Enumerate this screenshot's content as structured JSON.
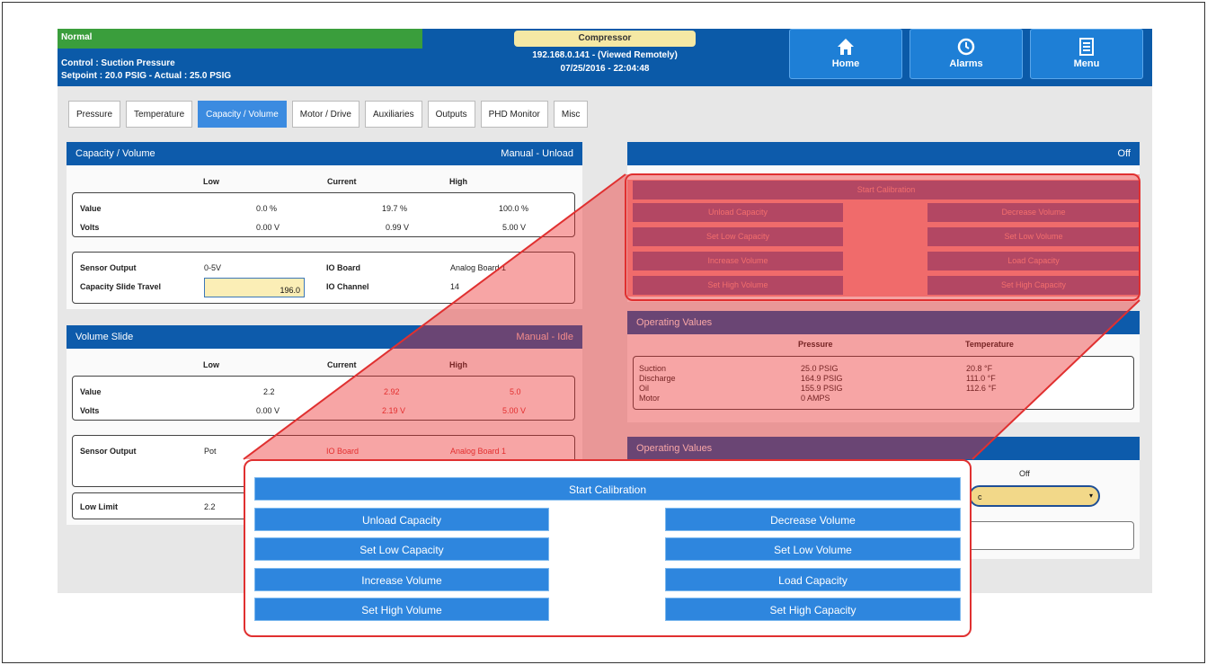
{
  "header": {
    "status": "Normal",
    "control": "Control : Suction Pressure",
    "setpoint": "Setpoint : 20.0 PSIG - Actual : 25.0 PSIG",
    "unit": "Compressor",
    "address": "192.168.0.141 - (Viewed Remotely)",
    "datetime": "07/25/2016 - 22:04:48",
    "nav": [
      {
        "label": "Home",
        "icon": "home-icon"
      },
      {
        "label": "Alarms",
        "icon": "clock-icon"
      },
      {
        "label": "Menu",
        "icon": "menu-icon"
      }
    ]
  },
  "tabs": [
    "Pressure",
    "Temperature",
    "Capacity / Volume",
    "Motor / Drive",
    "Auxiliaries",
    "Outputs",
    "PHD Monitor",
    "Misc"
  ],
  "active_tab": "Capacity / Volume",
  "capacity": {
    "title": "Capacity / Volume",
    "mode": "Manual - Unload",
    "cols": {
      "low": "Low",
      "current": "Current",
      "high": "High"
    },
    "value": {
      "label": "Value",
      "low": "0.0 %",
      "current": "19.7 %",
      "high": "100.0 %"
    },
    "volts": {
      "label": "Volts",
      "low": "0.00 V",
      "current": "0.99 V",
      "high": "5.00 V"
    },
    "sensor_output_label": "Sensor Output",
    "sensor_output": "0-5V",
    "io_board_label": "IO Board",
    "io_board": "Analog Board 1",
    "slide_travel_label": "Capacity Slide Travel",
    "slide_travel": "196.0",
    "io_channel_label": "IO Channel",
    "io_channel": "14"
  },
  "volume": {
    "title": "Volume Slide",
    "mode": "Manual - Idle",
    "cols": {
      "low": "Low",
      "current": "Current",
      "high": "High"
    },
    "value": {
      "label": "Value",
      "low": "2.2",
      "current": "2.92",
      "high": "5.0"
    },
    "volts": {
      "label": "Volts",
      "low": "0.00 V",
      "current": "2.19 V",
      "high": "5.00 V"
    },
    "sensor_output_label": "Sensor Output",
    "sensor_output": "Pot",
    "io_board_label": "IO Board",
    "io_board": "Analog Board 1",
    "low_limit_label": "Low Limit",
    "low_limit": "2.2"
  },
  "calibration": {
    "state": "Off",
    "start": "Start Calibration",
    "left": [
      "Unload Capacity",
      "Set Low Capacity",
      "Increase Volume",
      "Set High Volume"
    ],
    "right": [
      "Decrease Volume",
      "Set Low Volume",
      "Load Capacity",
      "Set High Capacity"
    ]
  },
  "operating": {
    "title": "Operating Values",
    "cols": {
      "pressure": "Pressure",
      "temperature": "Temperature"
    },
    "rows": [
      {
        "label": "Suction",
        "pressure": "25.0 PSIG",
        "temperature": "20.8 °F"
      },
      {
        "label": "Discharge",
        "pressure": "164.9 PSIG",
        "temperature": "111.0 °F"
      },
      {
        "label": "Oil",
        "pressure": "155.9 PSIG",
        "temperature": "112.6 °F"
      },
      {
        "label": "Motor",
        "pressure": "0 AMPS",
        "temperature": ""
      }
    ]
  },
  "operating2": {
    "title": "Operating Values",
    "state": "Off",
    "select_value": "c"
  },
  "colors": {
    "header": "#0b5aa8",
    "normal": "#3a9e3c",
    "button": "#2e86de",
    "highlight": "#e03030"
  }
}
